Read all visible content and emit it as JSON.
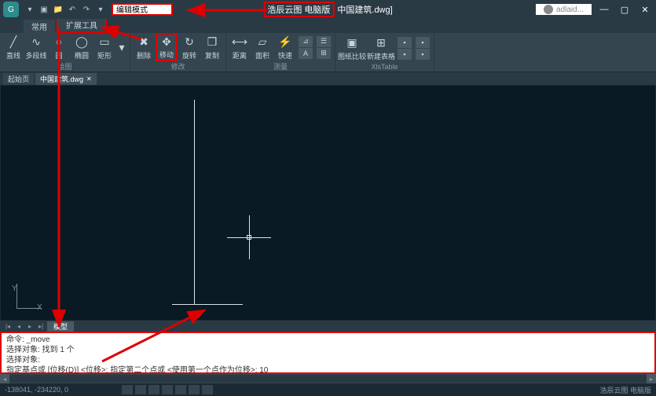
{
  "title": {
    "brand": "浩辰云图 电脑版",
    "file": "中国建筑.dwg]",
    "user": "adlaid...",
    "search_value": "编辑模式"
  },
  "tabs": {
    "main": "常用",
    "ext": "扩展工具"
  },
  "ribbon": {
    "draw": {
      "line": "直线",
      "polyline": "多段线",
      "circle": "圆",
      "ellipse": "椭圆",
      "rect": "矩形",
      "group": "绘图"
    },
    "edit": {
      "delete": "删除",
      "move": "移动",
      "rotate": "旋转",
      "copy": "复制",
      "group": "修改"
    },
    "measure": {
      "dist": "距离",
      "area": "面积",
      "quick": "快速",
      "group": "测量"
    },
    "compare": {
      "drawing": "图纸比较",
      "new_table": "新建表格",
      "xlstable": "XlsTable",
      "group": "图纸比较"
    }
  },
  "file_tabs": {
    "start": "起始页",
    "current": "中国建筑.dwg"
  },
  "ucs": {
    "x": "X",
    "y": "Y"
  },
  "layout": {
    "model": "模型"
  },
  "command": {
    "l1": "命令: _move",
    "l2": "选择对象: 找到 1 个",
    "l3": "选择对象:",
    "l4": "指定基点或 [位移(D)] <位移>:   指定第二个点或 <使用第一个点作为位移>: 10"
  },
  "status": {
    "coords": "-138041, -234220, 0",
    "brand_footer": "浩辰云图 电脑版"
  }
}
